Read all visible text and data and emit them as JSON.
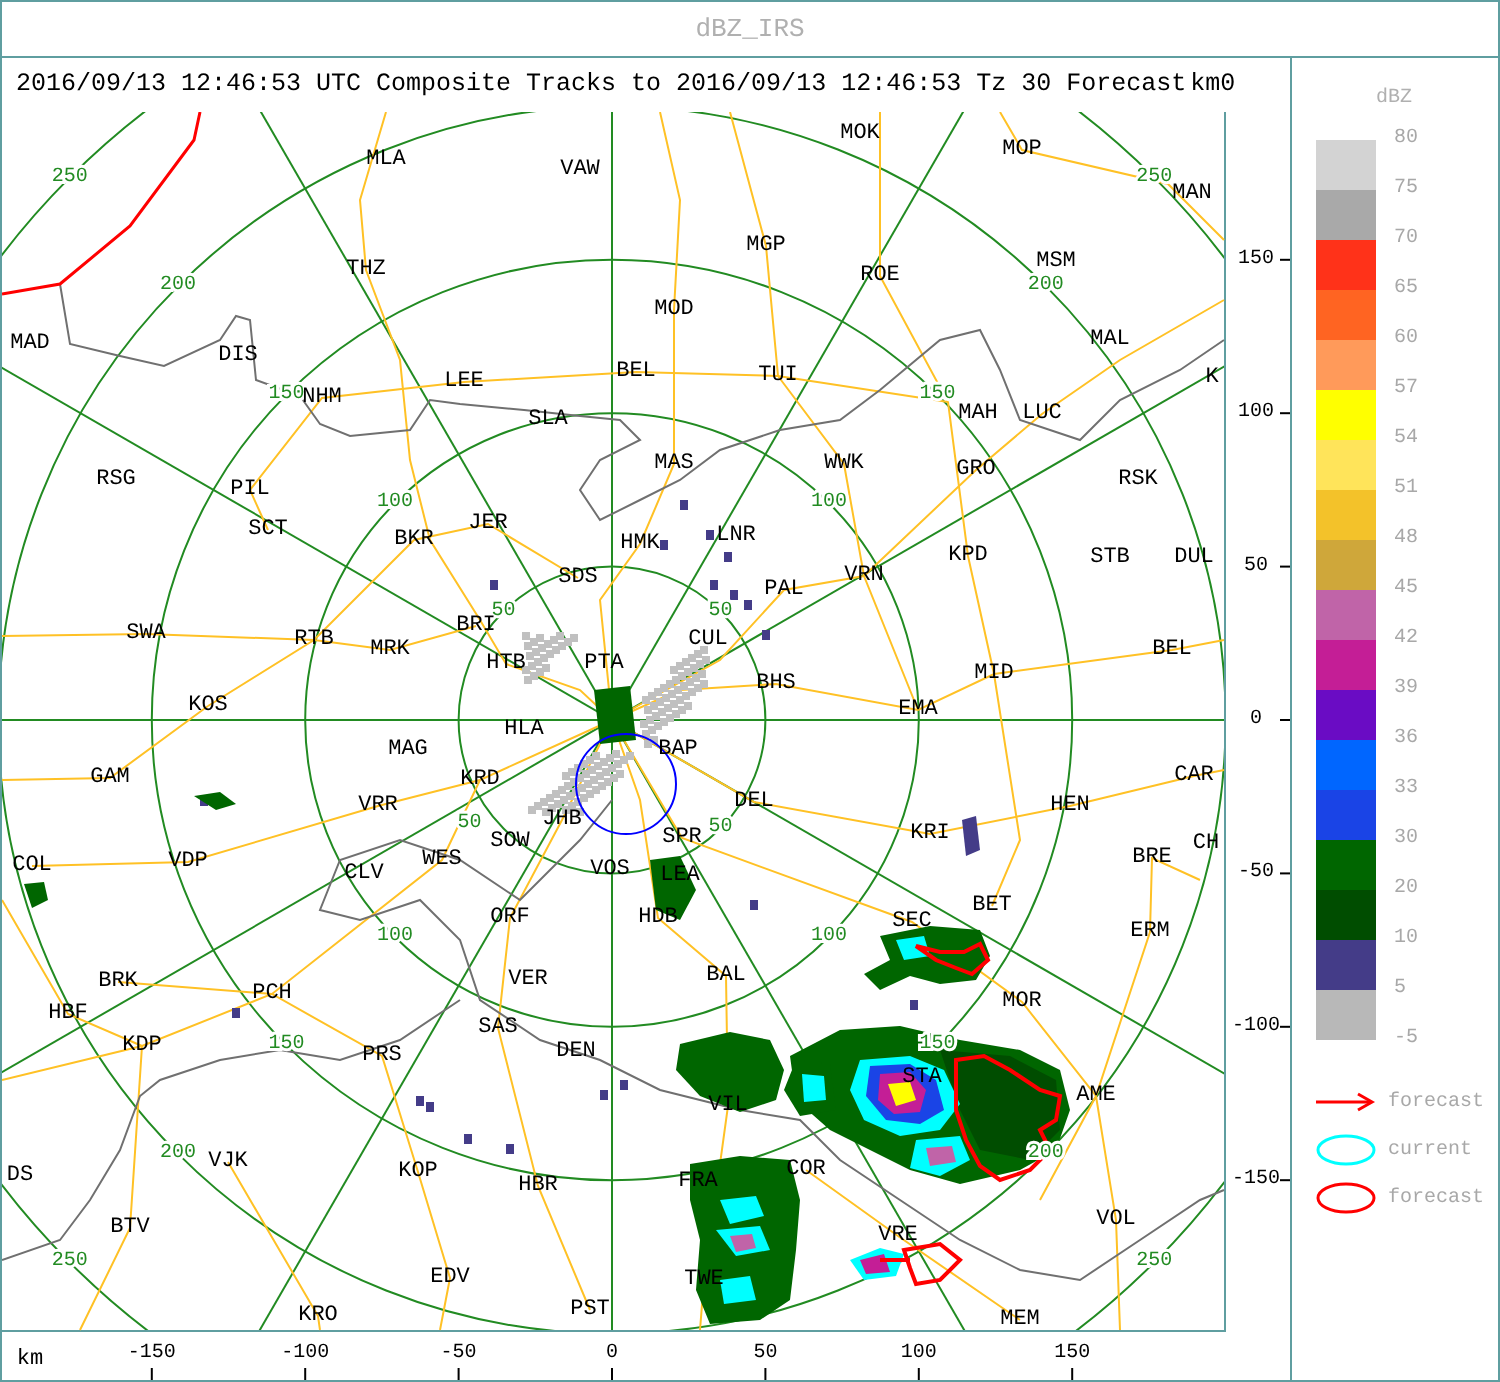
{
  "header": {
    "title": "dBZ_IRS"
  },
  "map": {
    "title": "2016/09/13 12:46:53 UTC Composite Tracks to 2016/09/13 12:46:53 Tz 30 Forecast",
    "top_unit_label": "km",
    "top_tick": "0",
    "cities": [
      "MOK",
      "MLA",
      "MOP",
      "VAW",
      "MAN",
      "MGP",
      "THZ",
      "ROE",
      "MSM",
      "MOD",
      "MAD",
      "DIS",
      "MAL",
      "LEE",
      "BEL",
      "TUI",
      "K",
      "NHM",
      "SLA",
      "MAH",
      "LUC",
      "RSG",
      "MAS",
      "WWK",
      "GRO",
      "PIL",
      "RSK",
      "SCT",
      "BKR",
      "JER",
      "HMK",
      "LNR",
      "KPD",
      "STB",
      "DUL",
      "SDS",
      "PAL",
      "VRN",
      "SWA",
      "RTB",
      "MRK",
      "BRI",
      "CUL",
      "BEL",
      "HTB",
      "PTA",
      "BHS",
      "MID",
      "KOS",
      "EMA",
      "HLA",
      "MAG",
      "BAP",
      "GAM",
      "KRD",
      "CAR",
      "VRR",
      "DEL",
      "HEN",
      "JHB",
      "SOW",
      "SPR",
      "KRI",
      "CH",
      "COL",
      "VDP",
      "CLV",
      "WES",
      "VOS",
      "LEA",
      "BRE",
      "ORF",
      "HDB",
      "SEC",
      "BET",
      "ERM",
      "BRK",
      "PCH",
      "VER",
      "BAL",
      "HBF",
      "MOR",
      "SAS",
      "KDP",
      "PRS",
      "DEN",
      "STA",
      "VIL",
      "AME",
      "DS",
      "VJK",
      "KOP",
      "HBR",
      "FRA",
      "COR",
      "BTV",
      "VRE",
      "VOL",
      "EDV",
      "TWE",
      "KRO",
      "PST",
      "MEM"
    ],
    "range_ring_labels": [
      "50",
      "100",
      "150",
      "200",
      "250",
      "50",
      "100",
      "150",
      "200",
      "250",
      "50",
      "100",
      "150",
      "200",
      "250",
      "50",
      "100",
      "150",
      "200",
      "250"
    ],
    "y_axis_ticks": [
      "150",
      "100",
      "50",
      "0",
      "-50",
      "-100",
      "-150"
    ],
    "x_axis_label": "km",
    "x_axis_ticks": [
      "-150",
      "-100",
      "-50",
      "0",
      "50",
      "100",
      "150"
    ]
  },
  "legend": {
    "title": "dBZ",
    "bins": [
      {
        "label": "80",
        "color": "#d3d3d3"
      },
      {
        "label": "75",
        "color": "#a9a9a9"
      },
      {
        "label": "70",
        "color": "#ff3219"
      },
      {
        "label": "65",
        "color": "#ff6422"
      },
      {
        "label": "60",
        "color": "#ff9a5a"
      },
      {
        "label": "57",
        "color": "#ffff00"
      },
      {
        "label": "54",
        "color": "#ffe45a"
      },
      {
        "label": "51",
        "color": "#f3c22a"
      },
      {
        "label": "48",
        "color": "#cfa73a"
      },
      {
        "label": "45",
        "color": "#c064a8"
      },
      {
        "label": "42",
        "color": "#c41e96"
      },
      {
        "label": "39",
        "color": "#6a0cc4"
      },
      {
        "label": "36",
        "color": "#0066ff"
      },
      {
        "label": "33",
        "color": "#1a44e6"
      },
      {
        "label": "30",
        "color": "#006600"
      },
      {
        "label": "20",
        "color": "#004d00"
      },
      {
        "label": "10",
        "color": "#443c88"
      },
      {
        "label": "5",
        "color": "#b8b8b8"
      }
    ],
    "bottom_label": "-5",
    "key": [
      {
        "kind": "arrow",
        "label": "forecast",
        "color": "#ff0000"
      },
      {
        "kind": "ellipse",
        "label": "current",
        "color": "#00ffff"
      },
      {
        "kind": "ellipse",
        "label": "forecast",
        "color": "#ff0000"
      }
    ]
  }
}
